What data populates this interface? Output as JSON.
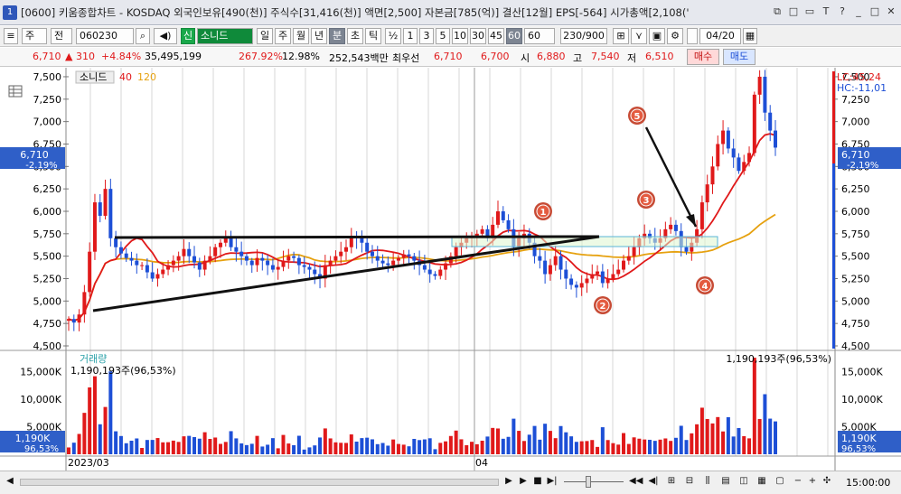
{
  "window": {
    "number": "1",
    "title": "[0600] 키움종합차트 - KOSDAQ 외국인보유[490(천)] 주식수[31,416(천)] 액면[2,500] 자본금[785(억)] 결산[12월] EPS[-564] 시가총액[2,108('"
  },
  "toolbar": {
    "market": "주",
    "type": "전",
    "code": "060230",
    "name_prefix": "신",
    "name": "소니드",
    "periods": [
      "일",
      "주",
      "월",
      "년",
      "분",
      "초",
      "틱"
    ],
    "half": "½",
    "minutes": [
      "1",
      "3",
      "5",
      "10",
      "30",
      "45",
      "60"
    ],
    "minute_select": "60",
    "count": "230/900",
    "date": "04/20"
  },
  "quote": {
    "price": "6,710",
    "change_arrow": "▲",
    "change": "310",
    "pct": "+4.84%",
    "volume": "35,495,199",
    "vol_ratio": "267.92%",
    "turnover": "12.98%",
    "amount": "252,543백만",
    "best_label": "최우선",
    "best_ask": "6,710",
    "best_bid": "6,700",
    "open_label": "시",
    "open": "6,880",
    "high_label": "고",
    "high": "7,540",
    "low_label": "저",
    "low": "6,510",
    "buy_label": "매수",
    "sell_label": "매도"
  },
  "price_panel": {
    "legend_name": "소니드",
    "ma1": "40",
    "ma2": "120",
    "lc": "LC:45,24",
    "hc": "HC:-11,01",
    "current": "6,710",
    "current_pct": "-2.19%",
    "y_ticks": [
      "7,500",
      "7,250",
      "7,000",
      "6,750",
      "6,500",
      "6,250",
      "6,000",
      "5,750",
      "5,500",
      "5,250",
      "5,000",
      "4,750",
      "4,500"
    ],
    "markers": [
      "1",
      "2",
      "3",
      "4",
      "5"
    ]
  },
  "volume_panel": {
    "title": "거래량",
    "info": "1,190,193주(96,53%)",
    "right_info": "1,190,193주(96,53%)",
    "y_ticks": [
      "15,000K",
      "10,000K",
      "5,000K"
    ],
    "current": "1,190K",
    "current_pct": "96,53%"
  },
  "footer": {
    "start_date": "2023/03",
    "mid_date": "04",
    "end_time": "15:00:00"
  },
  "colors": {
    "up": "#e0191a",
    "down": "#1d4fd6",
    "ma40": "#e0191a",
    "ma120": "#e6a10f",
    "accent": "#2f57b9"
  },
  "chart_data": {
    "type": "candlestick",
    "timeframe": "60min",
    "ylim": [
      4500,
      7550
    ],
    "moving_averages": [
      "40",
      "120"
    ],
    "closes": [
      4800,
      4760,
      4850,
      5100,
      5550,
      6100,
      5950,
      6250,
      5700,
      5600,
      5530,
      5480,
      5450,
      5400,
      5400,
      5320,
      5250,
      5300,
      5350,
      5400,
      5450,
      5500,
      5580,
      5500,
      5430,
      5350,
      5450,
      5500,
      5600,
      5650,
      5700,
      5600,
      5550,
      5500,
      5450,
      5400,
      5480,
      5450,
      5400,
      5350,
      5380,
      5450,
      5500,
      5480,
      5400,
      5380,
      5350,
      5300,
      5250,
      5400,
      5450,
      5500,
      5550,
      5600,
      5720,
      5700,
      5650,
      5550,
      5500,
      5450,
      5420,
      5400,
      5450,
      5480,
      5520,
      5500,
      5450,
      5400,
      5350,
      5300,
      5280,
      5350,
      5420,
      5500,
      5600,
      5650,
      5700,
      5720,
      5750,
      5800,
      5700,
      5850,
      6000,
      5900,
      5800,
      5600,
      5700,
      5750,
      5650,
      5500,
      5450,
      5300,
      5400,
      5500,
      5350,
      5250,
      5180,
      5150,
      5200,
      5250,
      5300,
      5330,
      5200,
      5250,
      5300,
      5350,
      5450,
      5500,
      5600,
      5700,
      5750,
      5700,
      5650,
      5700,
      5800,
      5850,
      5780,
      5600,
      5550,
      5650,
      5800,
      6100,
      6300,
      6500,
      6750,
      6900,
      6700,
      6600,
      6450,
      6550,
      6650,
      7300,
      7500,
      7100,
      6900,
      6710
    ]
  }
}
